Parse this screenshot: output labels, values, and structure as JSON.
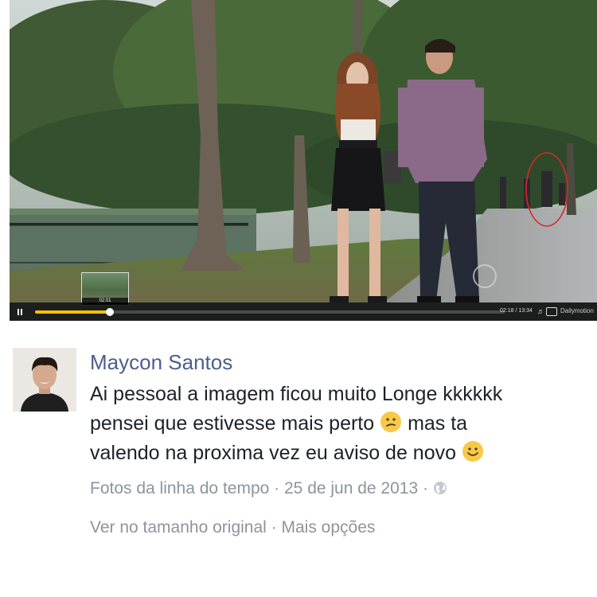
{
  "video": {
    "current_time": "02:18",
    "duration": "13:34",
    "time_label": "02:18 / 13:34",
    "preview_time": "02:01",
    "progress": 0.16,
    "brand": "Dailymotion",
    "accent_color": "#f2c200"
  },
  "comment": {
    "author": "Maycon Santos",
    "line1": "Ai pessoal a imagem ficou muito Longe kkkkkk",
    "line2": "pensei que estivesse mais perto",
    "line2b": "mas ta",
    "line3": "valendo na proxima vez eu aviso de novo",
    "emoji_1": "confused-face",
    "emoji_2": "smiling-face",
    "meta": {
      "album": "Fotos da linha do tempo",
      "date": "25 de jun de 2013",
      "separator": "·",
      "privacy_icon": "globe-icon"
    },
    "actions": {
      "view_original": "Ver no tamanho original",
      "more_options": "Mais opções",
      "separator": "·"
    },
    "author_color": "#4b5f8c",
    "meta_color": "#8d949e"
  }
}
